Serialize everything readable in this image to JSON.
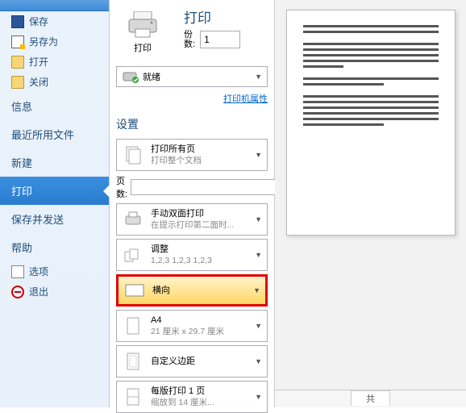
{
  "sidebar": {
    "items": [
      {
        "label": "保存"
      },
      {
        "label": "另存为"
      },
      {
        "label": "打开"
      },
      {
        "label": "关闭"
      },
      {
        "label": "信息"
      },
      {
        "label": "最近所用文件"
      },
      {
        "label": "新建"
      },
      {
        "label": "打印"
      },
      {
        "label": "保存并发送"
      },
      {
        "label": "帮助"
      },
      {
        "label": "选项"
      },
      {
        "label": "退出"
      }
    ]
  },
  "print": {
    "title": "打印",
    "button_label": "打印",
    "copies_label1": "份",
    "copies_label2": "数:",
    "copies_value": "1",
    "printer_status": "就绪",
    "printer_props": "打印机属性",
    "settings_title": "设置",
    "pages_label1": "页",
    "pages_label2": "数:",
    "pages_value": ""
  },
  "settings": {
    "print_all": {
      "title": "打印所有页",
      "sub": "打印整个文档"
    },
    "duplex": {
      "title": "手动双面打印",
      "sub": "在提示打印第二面时..."
    },
    "collate": {
      "title": "调整",
      "sub": "1,2,3    1,2,3    1,2,3"
    },
    "orientation": {
      "title": "横向"
    },
    "paper": {
      "title": "A4",
      "sub": "21 厘米 x 29.7 厘米"
    },
    "margins": {
      "title": "自定义边距"
    },
    "per_sheet": {
      "title": "每版打印 1 页",
      "sub": "缩放到 14 厘米..."
    }
  },
  "footer": {
    "label": "共"
  }
}
